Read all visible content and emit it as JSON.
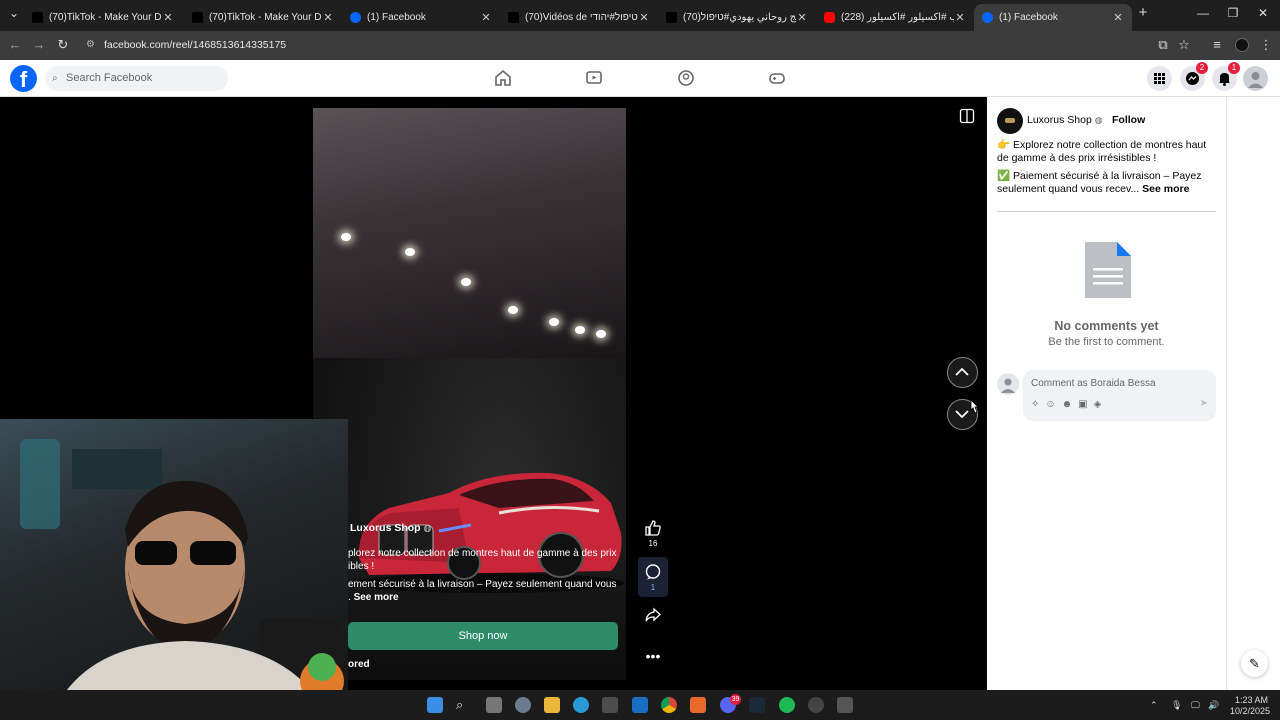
{
  "browser": {
    "tabs": [
      {
        "title": "(70)TikTok - Make Your Day",
        "icon": "tiktok-icon"
      },
      {
        "title": "(70)TikTok - Make Your Day",
        "icon": "tiktok-icon"
      },
      {
        "title": "(1) Facebook",
        "icon": "facebook-icon"
      },
      {
        "title": "(70)Vidéos de יהודי#טיפול#יהודי",
        "icon": "tiktok-icon"
      },
      {
        "title": "معالج روحاني يهودي#טיפול(70)",
        "icon": "tiktok-icon"
      },
      {
        "title": "(228) المغرب #اكسيلور #اكسيلور",
        "icon": "youtube-icon"
      },
      {
        "title": "(1) Facebook",
        "icon": "facebook-icon",
        "active": true
      }
    ],
    "new_tab": "+",
    "url": "facebook.com/reel/1468513614335175"
  },
  "facebook": {
    "logo": "f",
    "search_placeholder": "Search Facebook",
    "messenger_badge": "2",
    "notifications_badge": "1"
  },
  "reel": {
    "page_name": "Luxorus Shop",
    "caption_line1": "plorez notre collection de montres haut de gamme à des prix",
    "caption_line2": "ibles !",
    "caption_line3": "ement sécurisé à la livraison – Payez seulement quand vous",
    "caption_line4": ".",
    "see_more": "See more",
    "cta": "Shop now",
    "sponsored": "ored",
    "likes": "16",
    "comments": "1"
  },
  "panel": {
    "page_name": "Luxorus Shop",
    "follow": "Follow",
    "desc1": "👉 Explorez notre collection de montres haut de gamme à des prix irrésistibles !",
    "desc2": "✅ Paiement sécurisé à la livraison – Payez seulement quand vous recev...",
    "see_more": "See more",
    "no_comments": "No comments yet",
    "be_first": "Be the first to comment.",
    "comment_placeholder": "Comment as Boraida Bessa"
  },
  "taskbar": {
    "time": "1:23 AM",
    "date": "10/2/2025",
    "badge": "39"
  },
  "colors": {
    "fb_blue": "#0866ff",
    "cta_green": "#2e8b6a",
    "badge_red": "#e41e3f"
  }
}
